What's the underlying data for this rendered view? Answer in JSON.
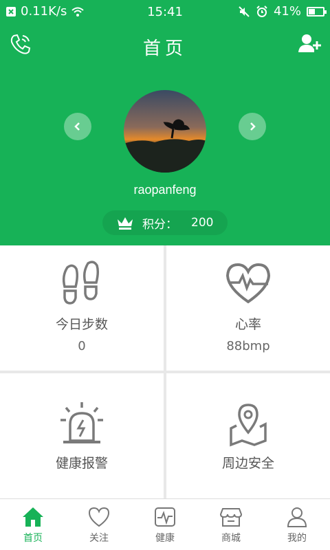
{
  "status_bar": {
    "network_speed": "0.11K/s",
    "time": "15:41",
    "battery": "41%",
    "battery_level": 0.41,
    "icons": [
      "notification-icon",
      "wifi-icon",
      "mute-icon",
      "alarm-icon",
      "battery-icon"
    ]
  },
  "header": {
    "title": "首页",
    "left_icon": "phone-icon",
    "right_icon": "add-user-icon"
  },
  "profile": {
    "username": "raopanfeng",
    "points_label": "积分：",
    "points_value": "200"
  },
  "features": [
    {
      "label": "今日步数",
      "value": "0",
      "icon": "footprints-icon"
    },
    {
      "label": "心率",
      "value": "88bmp",
      "icon": "heart-rate-icon"
    },
    {
      "label": "健康报警",
      "icon": "alarm-siren-icon"
    },
    {
      "label": "周边安全",
      "icon": "map-pin-icon"
    }
  ],
  "tabs": [
    {
      "label": "首页",
      "icon": "home-icon",
      "active": true
    },
    {
      "label": "关注",
      "icon": "heart-icon"
    },
    {
      "label": "健康",
      "icon": "pulse-icon"
    },
    {
      "label": "商城",
      "icon": "store-icon"
    },
    {
      "label": "我的",
      "icon": "user-icon"
    }
  ],
  "colors": {
    "primary": "#17b257",
    "icon_gray": "#7a7a7a",
    "text": "#555555"
  }
}
